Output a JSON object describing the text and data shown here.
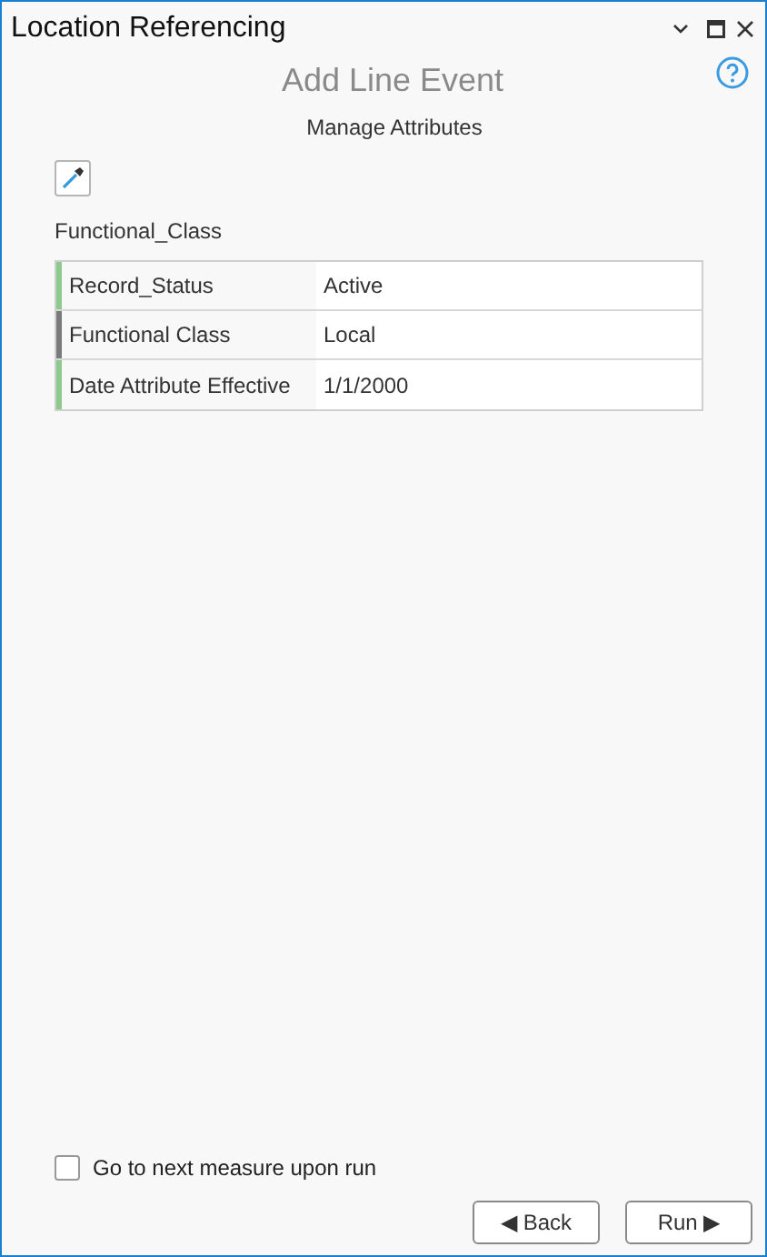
{
  "window": {
    "title": "Location Referencing"
  },
  "heading": "Add Line Event",
  "subheading": "Manage Attributes",
  "table_title": "Functional_Class",
  "rows": [
    {
      "name": "Record_Status",
      "value": "Active",
      "color": "#8cc98c"
    },
    {
      "name": "Functional Class",
      "value": "Local",
      "color": "#7a7a7a"
    },
    {
      "name": "Date Attribute Effective",
      "value": "1/1/2000",
      "color": "#8cc98c"
    }
  ],
  "option": {
    "label": "Go to next measure upon run",
    "checked": false
  },
  "buttons": [
    "◀ Back",
    "Run ▶"
  ]
}
